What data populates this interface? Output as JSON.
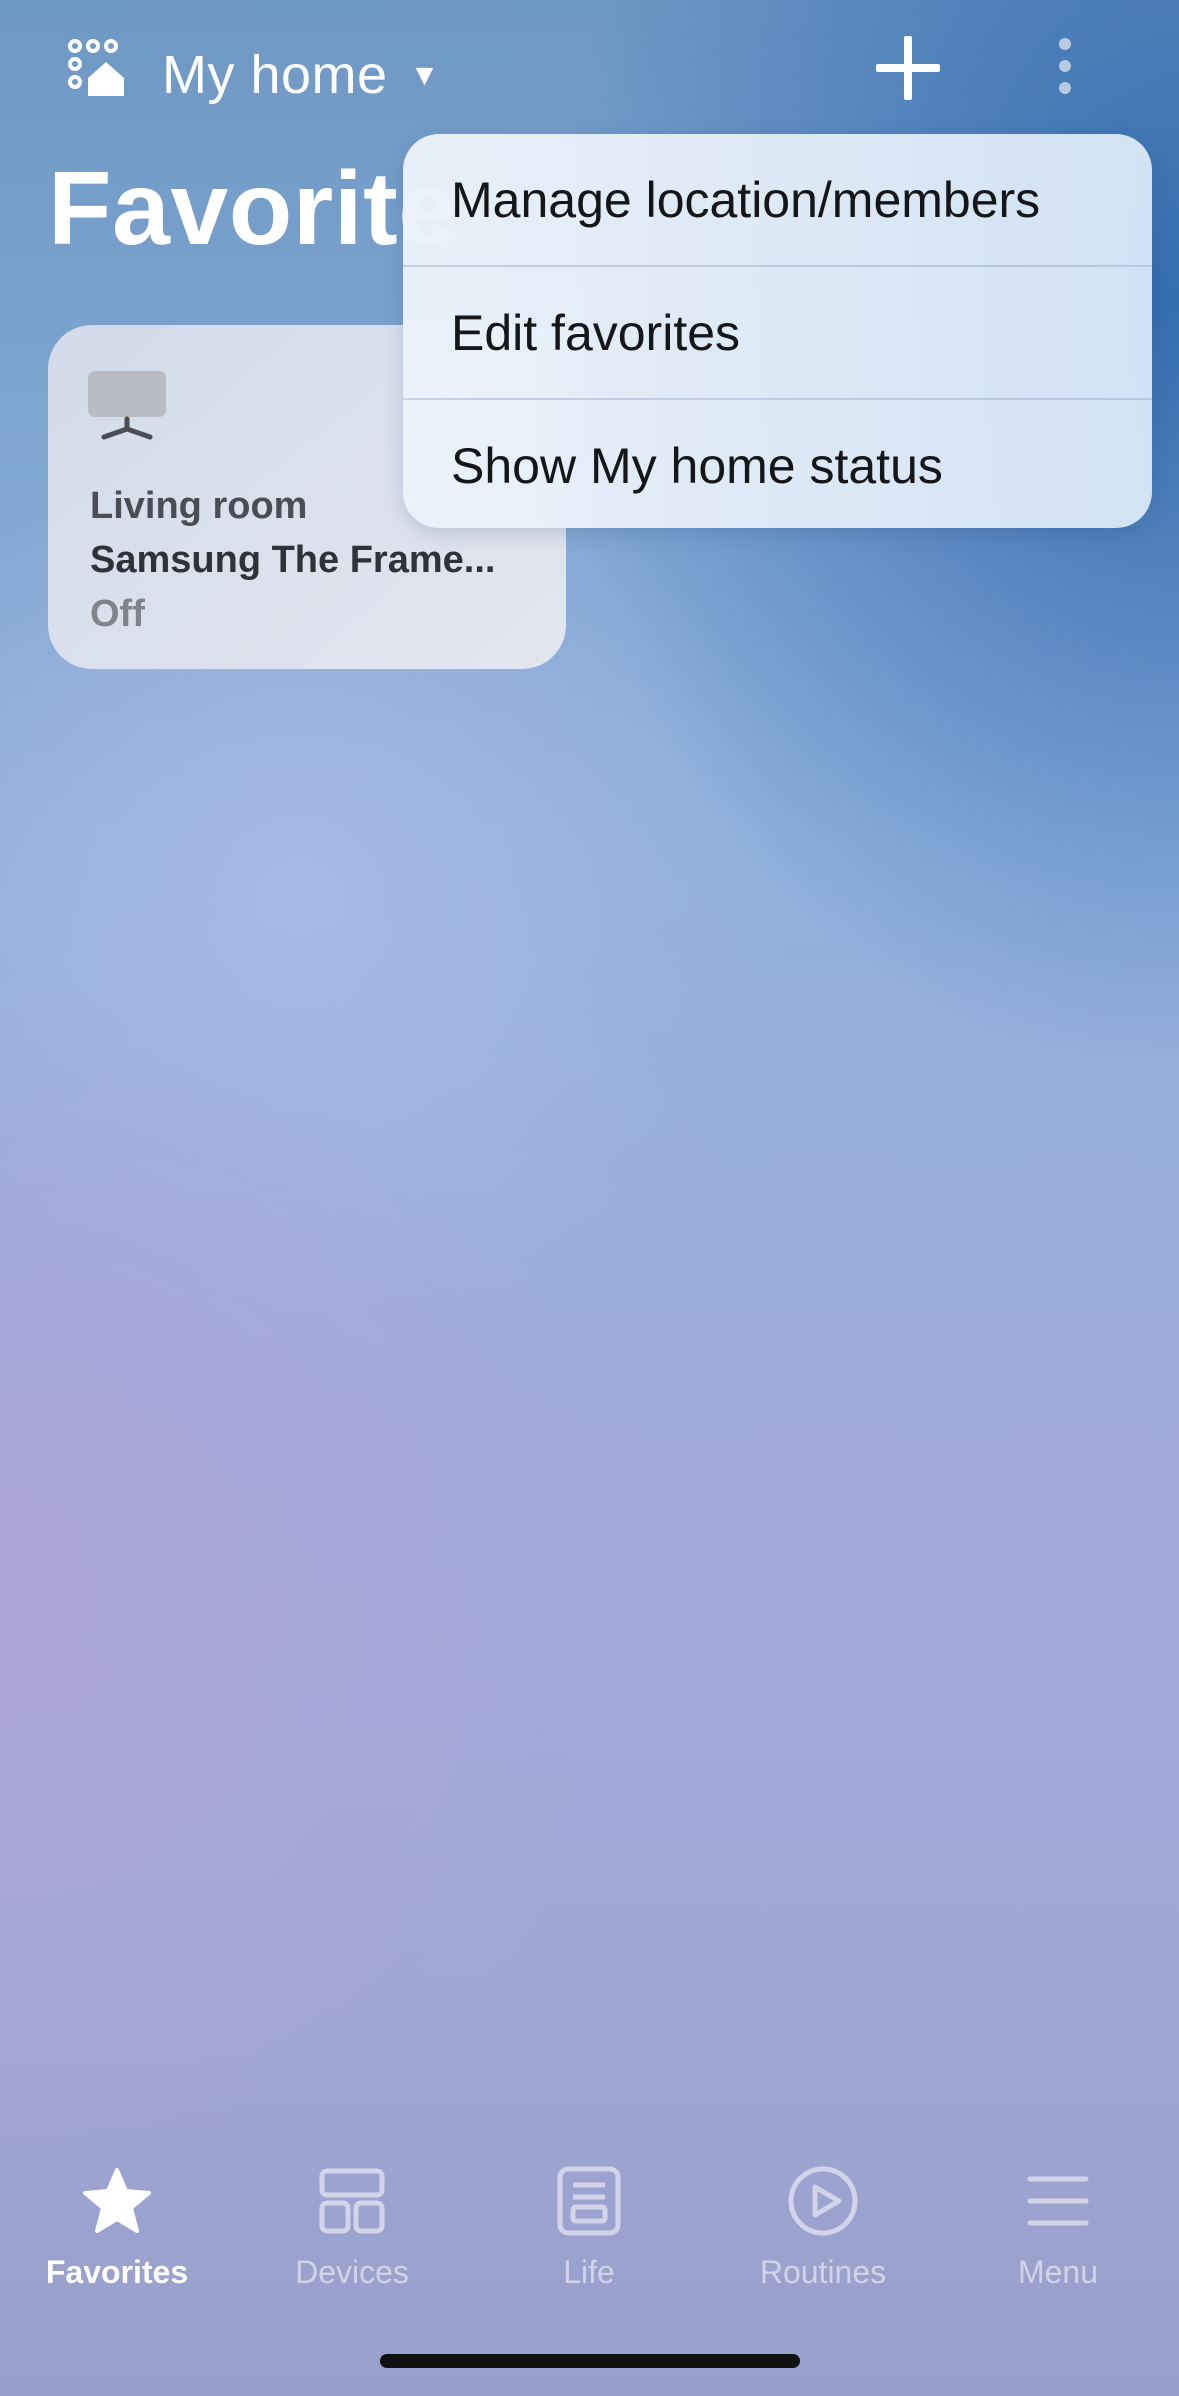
{
  "header": {
    "location_label": "My home",
    "caret": "▼",
    "title": "Favorite"
  },
  "favorites": [
    {
      "room": "Living room",
      "name": "Samsung The Frame...",
      "status": "Off",
      "icon": "tv-icon"
    }
  ],
  "menu": {
    "items": [
      {
        "label": "Manage location/members"
      },
      {
        "label": "Edit favorites"
      },
      {
        "label": "Show My home status"
      }
    ]
  },
  "bottom_nav": {
    "items": [
      {
        "label": "Favorites",
        "icon": "star-icon",
        "active": true
      },
      {
        "label": "Devices",
        "icon": "devices-icon",
        "active": false
      },
      {
        "label": "Life",
        "icon": "life-icon",
        "active": false
      },
      {
        "label": "Routines",
        "icon": "play-circle-icon",
        "active": false
      },
      {
        "label": "Menu",
        "icon": "hamburger-icon",
        "active": false
      }
    ]
  },
  "colors": {
    "menu_text": "#14161a",
    "card_status": "#80838c",
    "nav_active": "#ffffff"
  }
}
